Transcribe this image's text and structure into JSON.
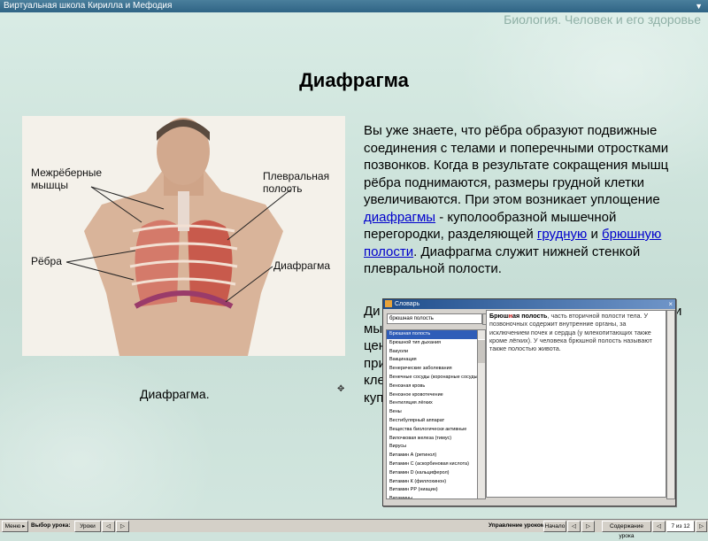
{
  "window": {
    "title": "Виртуальная школа Кирилла и Мефодия",
    "minimize": "▼"
  },
  "subject": "Биология. Человек и его здоровье",
  "heading": "Диафрагма",
  "illustration": {
    "labels": {
      "intercostal": "Межрёберные\nмышцы",
      "pleural": "Плевральная\nполость",
      "ribs": "Рёбра",
      "diaphragm": "Диафрагма"
    },
    "caption": "Диафрагма."
  },
  "paragraph": {
    "part1": "Вы уже знаете, что рёбра образуют подвижные соединения с телами и поперечными отростками позвонков. Когда в результате сокращения мышц рёбра поднимаются, размеры грудной клетки увеличиваются. При этом возникает уплощение ",
    "link1": "диафрагмы",
    "part2": " - куполообразной мышечной перегородки, разделяющей ",
    "link2": "грудную",
    "part3": " и ",
    "link3": "брюшную полости",
    "part4": ". Диафрагма служит нижней стенкой плевральной полости."
  },
  "paragraph2": {
    "lines": [
      "Ди",
      "мы",
      "цен",
      "при",
      "клет",
      "куп"
    ],
    "line1_tail": "и"
  },
  "dictionary": {
    "title": "Словарь",
    "close": "×",
    "search_value": "брюшная полость",
    "go": "▸",
    "items": [
      "Брюшная полость",
      "Брюшной тип дыхания",
      "Вакуоли",
      "Вакцинация",
      "Венерические заболевания",
      "Венечные сосуды (коронарные сосуды)",
      "Венозная кровь",
      "Венозное кровотечение",
      "Вентиляция лёгких",
      "Вены",
      "Вестибулярный аппарат",
      "Вещества биологически активные",
      "Вилочковая железа (тимус)",
      "Вирусы",
      "Витамин А (ретинол)",
      "Витамин С (аскорбиновая кислота)",
      "Витамин D (кальциферол)",
      "Витамин К (филлохинон)",
      "Витамин РР (ниацин)",
      "Витамины"
    ],
    "selected_index": 0,
    "definition": {
      "term_a": "Брюш",
      "term_hl": "н",
      "term_b": "ая полость",
      "text": ", часть вторичной полости тела. У позвоночных содержит внутренние органы, за исключением почек и сердца (у млекопитающих также кроме лёгких). У человека брюшной полость называют также полостью живота."
    }
  },
  "bottombar": {
    "menu": "Меню",
    "menu_arrow": "▸",
    "lesson_select_label": "Выбор урока:",
    "lessons": "Уроки",
    "back": "◁",
    "forward": "▷",
    "lesson_control_label": "Управление уроком:",
    "start": "Начало",
    "contents": "Содержание урока",
    "page": "7 из 12"
  },
  "colors": {
    "link": "#0000cc",
    "titlebar": "#2f6485",
    "selection": "#2f5db8"
  }
}
